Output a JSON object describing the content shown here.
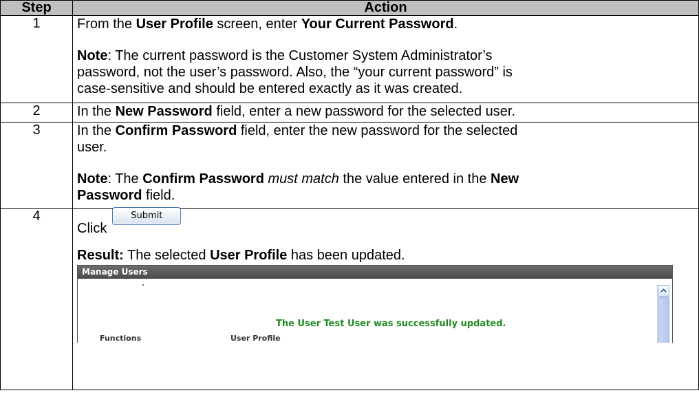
{
  "table": {
    "headers": {
      "step": "Step",
      "action": "Action"
    },
    "rows": [
      {
        "step": "1",
        "p1": {
          "a": "From the ",
          "b": "User Profile",
          "c": " screen, enter ",
          "d": "Your Current Password",
          "e": "."
        },
        "note": {
          "label": "Note",
          "line1": ":  The current password is the Customer System Administrator’s",
          "line2": "password, not the user’s password.  Also, the “your current password” is",
          "line3": "case-sensitive and should be entered exactly as it was created."
        }
      },
      {
        "step": "2",
        "p1": {
          "a": "In the ",
          "b": "New Password",
          "c": " field, enter a new password for the selected user."
        }
      },
      {
        "step": "3",
        "p1": {
          "a": "In the ",
          "b": "Confirm Password",
          "c": " field, enter the new password for the selected",
          "d": "user."
        },
        "note": {
          "label": "Note",
          "a": ": The ",
          "b": "Confirm Password",
          "c": " ",
          "d": "must match",
          "e": " the value entered in the ",
          "f": "New",
          "g": "Password",
          "h": " field."
        }
      },
      {
        "step": "4",
        "click_text": "Click",
        "submit_label": "Submit",
        "result": {
          "label": "Result:",
          "a": "  The selected ",
          "b": "User Profile",
          "c": " has been updated."
        },
        "screenshot": {
          "title": "Manage Users",
          "message": "The User Test User was successfully updated.",
          "functions_label": "Functions",
          "user_profile_label": "User Profile"
        }
      }
    ]
  },
  "colors": {
    "header_bg": "#c0c0c0",
    "success_green": "#1f8a1f",
    "panel_title_bg": "#555555"
  },
  "icons": {
    "scroll_up": "chevron-up-icon"
  }
}
